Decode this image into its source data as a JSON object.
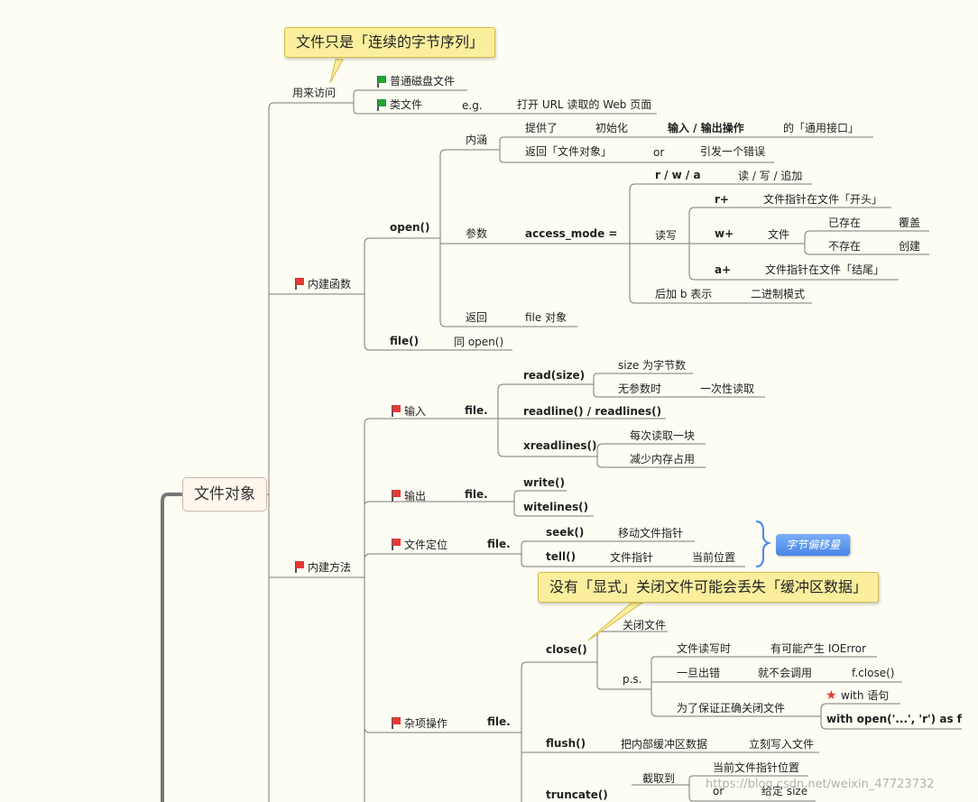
{
  "callouts": {
    "top": "文件只是「连续的字节序列」",
    "middle": "没有「显式」关闭文件可能会丢失「缓冲区数据」"
  },
  "root": "文件对象",
  "access": {
    "label": "用来访问",
    "regular": "普通磁盘文件",
    "filelike": "类文件",
    "eg": "e.g.",
    "eg_text": "打开 URL 读取的 Web 页面"
  },
  "builtin_func": {
    "label": "内建函数",
    "open": "open()",
    "content": {
      "label": "内涵",
      "provides": "提供了",
      "init": "初始化",
      "io": "输入 / 输出操作",
      "generic": "的「通用接口」",
      "returns": "返回「文件对象」",
      "or": "or",
      "raise": "引发一个错误"
    },
    "params": {
      "label": "参数",
      "access_mode": "access_mode =",
      "rwa": "r / w / a",
      "rwa_desc": "读 / 写 / 追加",
      "rw": "读写",
      "r_plus": "r+",
      "r_plus_desc": "文件指针在文件「开头」",
      "w_plus": "w+",
      "w_plus_file": "文件",
      "exists": "已存在",
      "overwrite": "覆盖",
      "not_exists": "不存在",
      "create": "创建",
      "a_plus": "a+",
      "a_plus_desc": "文件指针在文件「结尾」",
      "b_suffix": "后加 b 表示",
      "binary": "二进制模式"
    },
    "return": {
      "label": "返回",
      "value": "file 对象"
    },
    "file": "file()",
    "same_as_open": "同 open()"
  },
  "builtin_methods": {
    "label": "内建方法",
    "input": {
      "label": "输入",
      "file": "file.",
      "read": "read(size)",
      "size_bytes": "size 为字节数",
      "no_param": "无参数时",
      "read_all": "一次性读取",
      "readline": "readline() / readlines()",
      "xreadlines": "xreadlines()",
      "per_block": "每次读取一块",
      "less_memory": "减少内存占用"
    },
    "output": {
      "label": "输出",
      "file": "file.",
      "write": "write()",
      "writelines": "witelines()"
    },
    "position": {
      "label": "文件定位",
      "file": "file.",
      "seek": "seek()",
      "seek_desc": "移动文件指针",
      "tell": "tell()",
      "tell_ptr": "文件指针",
      "tell_cur": "当前位置",
      "byte_offset": "字节偏移量"
    },
    "misc": {
      "label": "杂项操作",
      "file": "file.",
      "close": "close()",
      "close_file": "关闭文件",
      "ps": "p.s.",
      "rw_time": "文件读写时",
      "may_ioerror": "有可能产生 IOError",
      "once_error": "一旦出错",
      "wont_call": "就不会调用",
      "fclose": "f.close()",
      "to_ensure": "为了保证正确关闭文件",
      "with_stmt": "with 语句",
      "with_open": "with open('...', 'r') as f",
      "flush": "flush()",
      "flush_buf": "把内部缓冲区数据",
      "flush_write": "立刻写入文件",
      "truncate": "truncate()",
      "truncate_to": "截取到",
      "cur_ptr": "当前文件指针位置",
      "or": "or",
      "given_size": "给定 size"
    }
  },
  "watermark": "https://blog.csdn.net/weixin_47723732"
}
